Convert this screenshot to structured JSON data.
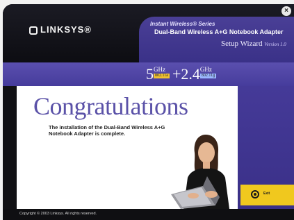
{
  "window": {
    "close_label": "×"
  },
  "header": {
    "logo_text": "LINKSYS®",
    "series": "Instant Wireless® Series",
    "product_name": "Dual-Band Wireless A+G Notebook Adapter",
    "wizard_title": "Setup Wizard",
    "wizard_version": "Version 1.0"
  },
  "band": {
    "primary": "5",
    "primary_unit": "GHz",
    "primary_tag": "802.11a",
    "plus": "+2.4",
    "secondary_unit": "GHz",
    "secondary_tag": "802.11g"
  },
  "content": {
    "heading": "Congratulations",
    "message": "The installation of the Dual-Band Wireless A+G Notebook Adapter is complete."
  },
  "actions": {
    "exit_label": "Exit"
  },
  "footer": {
    "copyright": "Copyright © 2003 Linksys. All rights reserved."
  },
  "colors": {
    "brand_purple": "#463c9c",
    "heading_purple": "#5b52a8",
    "exit_yellow": "#f0c81e",
    "header_black": "#111114"
  }
}
